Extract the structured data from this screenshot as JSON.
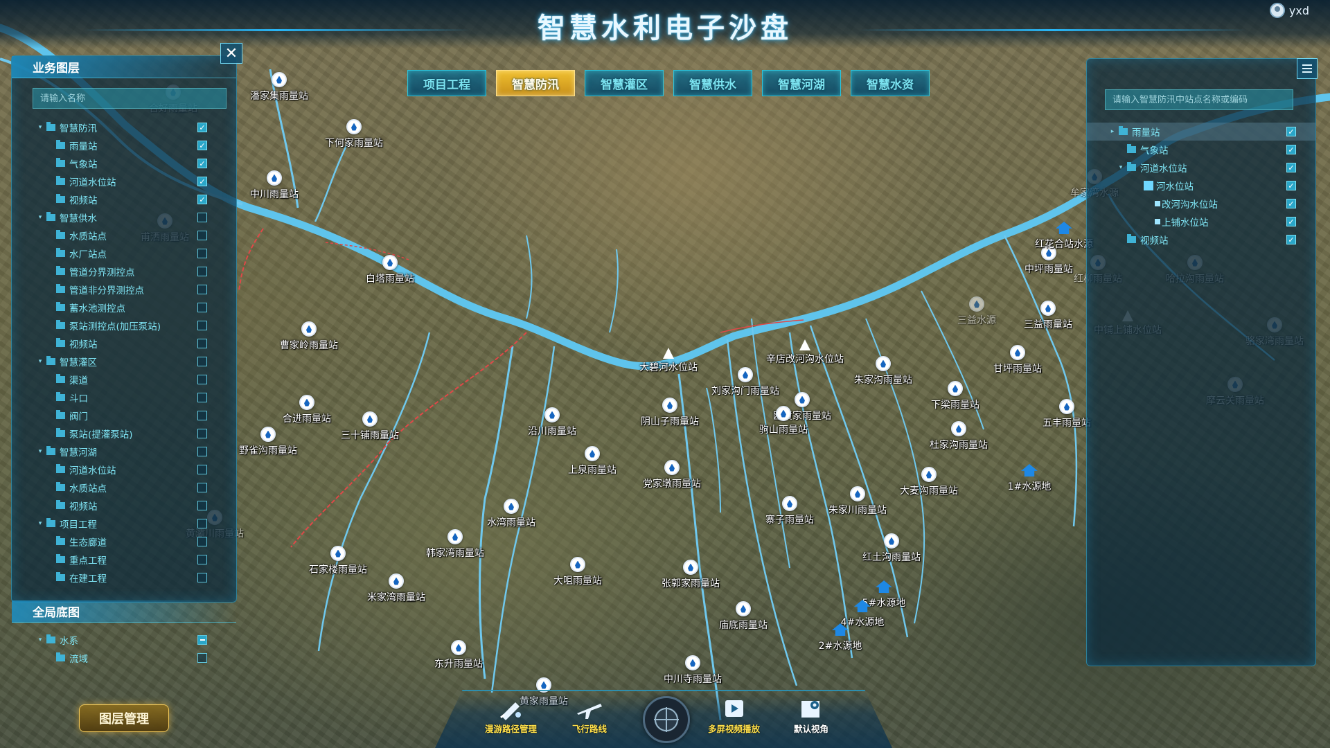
{
  "header": {
    "title": "智慧水利电子沙盘",
    "user": "yxd"
  },
  "tabs": [
    {
      "label": "项目工程",
      "active": false
    },
    {
      "label": "智慧防汛",
      "active": true
    },
    {
      "label": "智慧灌区",
      "active": false
    },
    {
      "label": "智慧供水",
      "active": false
    },
    {
      "label": "智慧河湖",
      "active": false
    },
    {
      "label": "智慧水资",
      "active": false
    }
  ],
  "layer_panel": {
    "title": "业务图层",
    "search_placeholder": "请输入名称",
    "base_title": "全局底图",
    "tree": [
      {
        "label": "智慧防汛",
        "level": 0,
        "check": "on"
      },
      {
        "label": "雨量站",
        "level": 1,
        "check": "on"
      },
      {
        "label": "气象站",
        "level": 1,
        "check": "on"
      },
      {
        "label": "河道水位站",
        "level": 1,
        "check": "on"
      },
      {
        "label": "视频站",
        "level": 1,
        "check": "on"
      },
      {
        "label": "智慧供水",
        "level": 0,
        "check": "off"
      },
      {
        "label": "水质站点",
        "level": 1,
        "check": "off"
      },
      {
        "label": "水厂站点",
        "level": 1,
        "check": "off"
      },
      {
        "label": "管道分界测控点",
        "level": 1,
        "check": "off"
      },
      {
        "label": "管道非分界测控点",
        "level": 1,
        "check": "off"
      },
      {
        "label": "蓄水池测控点",
        "level": 1,
        "check": "off"
      },
      {
        "label": "泵站测控点(加压泵站)",
        "level": 1,
        "check": "off"
      },
      {
        "label": "视频站",
        "level": 1,
        "check": "off"
      },
      {
        "label": "智慧灌区",
        "level": 0,
        "check": "off"
      },
      {
        "label": "渠道",
        "level": 1,
        "check": "off"
      },
      {
        "label": "斗口",
        "level": 1,
        "check": "off"
      },
      {
        "label": "阀门",
        "level": 1,
        "check": "off"
      },
      {
        "label": "泵站(提灌泵站)",
        "level": 1,
        "check": "off"
      },
      {
        "label": "智慧河湖",
        "level": 0,
        "check": "off"
      },
      {
        "label": "河道水位站",
        "level": 1,
        "check": "off"
      },
      {
        "label": "水质站点",
        "level": 1,
        "check": "off"
      },
      {
        "label": "视频站",
        "level": 1,
        "check": "off"
      },
      {
        "label": "项目工程",
        "level": 0,
        "check": "off"
      },
      {
        "label": "生态廊道",
        "level": 1,
        "check": "off"
      },
      {
        "label": "重点工程",
        "level": 1,
        "check": "off"
      },
      {
        "label": "在建工程",
        "level": 1,
        "check": "off"
      }
    ],
    "base_tree": [
      {
        "label": "水系",
        "level": 0,
        "check": "partial"
      },
      {
        "label": "流域",
        "level": 1,
        "check": "off"
      }
    ],
    "manage_button": "图层管理"
  },
  "right_panel": {
    "search_placeholder": "请输入智慧防汛中站点名称或编码",
    "tree": [
      {
        "label": "雨量站",
        "level": 0,
        "check": "on",
        "arrow": "▸",
        "highlight": true
      },
      {
        "label": "气象站",
        "level": 1,
        "check": "on"
      },
      {
        "label": "河道水位站",
        "level": 1,
        "check": "on",
        "arrow": "▾"
      },
      {
        "label": "河水位站",
        "level": 2,
        "check": "on",
        "marker": "square"
      },
      {
        "label": "改河沟水位站",
        "level": 3,
        "check": "on",
        "marker": "small"
      },
      {
        "label": "上铺水位站",
        "level": 3,
        "check": "on",
        "marker": "small"
      },
      {
        "label": "视频站",
        "level": 1,
        "check": "on"
      }
    ]
  },
  "toolbar": {
    "tools": [
      {
        "label": "漫游路径管理",
        "icon": "path-edit-icon"
      },
      {
        "label": "飞行路线",
        "icon": "plane-icon"
      },
      {
        "label": "多屏视频播放",
        "icon": "video-icon"
      },
      {
        "label": "默认视角",
        "icon": "map-pin-icon"
      }
    ],
    "compass_icon": "compass-icon"
  },
  "stations": [
    {
      "name": "潘家集雨量站"
    },
    {
      "name": "下何家雨量站"
    },
    {
      "name": "合好雨量站",
      "faded": true
    },
    {
      "name": "中川雨量站"
    },
    {
      "name": "甫洒雨量站",
      "faded": true
    },
    {
      "name": "白塔雨量站"
    },
    {
      "name": "曹家岭雨量站"
    },
    {
      "name": "合进雨量站"
    },
    {
      "name": "三十铺雨量站"
    },
    {
      "name": "野雀沟雨量站"
    },
    {
      "name": "沿川雨量站"
    },
    {
      "name": "上泉雨量站"
    },
    {
      "name": "大碧河水位站",
      "type": "tri"
    },
    {
      "name": "阴山子雨量站"
    },
    {
      "name": "刘家沟门雨量站"
    },
    {
      "name": "辛店改河沟水位站",
      "type": "tri"
    },
    {
      "name": "欧黄家雨量站"
    },
    {
      "name": "朱家沟雨量站"
    },
    {
      "name": "驹山雨量站"
    },
    {
      "name": "党家墩雨量站"
    },
    {
      "name": "水湾雨量站"
    },
    {
      "name": "韩家湾雨量站"
    },
    {
      "name": "石家楼雨量站"
    },
    {
      "name": "米家湾雨量站"
    },
    {
      "name": "大咀雨量站"
    },
    {
      "name": "张郭家雨量站"
    },
    {
      "name": "庙底雨量站"
    },
    {
      "name": "寨子雨量站"
    },
    {
      "name": "朱家川雨量站"
    },
    {
      "name": "红土沟雨量站"
    },
    {
      "name": "东升雨量站"
    },
    {
      "name": "黄灞川雨量站",
      "faded": true
    },
    {
      "name": "下梁雨量站"
    },
    {
      "name": "杜家沟雨量站"
    },
    {
      "name": "大麦沟雨量站"
    },
    {
      "name": "1#水源地",
      "type": "src"
    },
    {
      "name": "5#水源地",
      "type": "src"
    },
    {
      "name": "4#水源地",
      "type": "src"
    },
    {
      "name": "2#水源地",
      "type": "src"
    },
    {
      "name": "中坪雨量站"
    },
    {
      "name": "红花合站水源",
      "type": "src"
    },
    {
      "name": "红柳雨量站",
      "faded": true
    },
    {
      "name": "三益雨量站"
    },
    {
      "name": "三益水源",
      "faded": true
    },
    {
      "name": "甘坪雨量站"
    },
    {
      "name": "五丰雨量站"
    },
    {
      "name": "哈拉沟雨量站",
      "faded": true
    },
    {
      "name": "中铺上铺水位站",
      "type": "tri",
      "faded": true
    },
    {
      "name": "骆家湾雨量站",
      "faded": true
    },
    {
      "name": "摩云关雨量站",
      "faded": true
    },
    {
      "name": "牟家湾水源",
      "faded": true
    },
    {
      "name": "中川寺雨量站"
    },
    {
      "name": "黄家雨量站"
    }
  ]
}
